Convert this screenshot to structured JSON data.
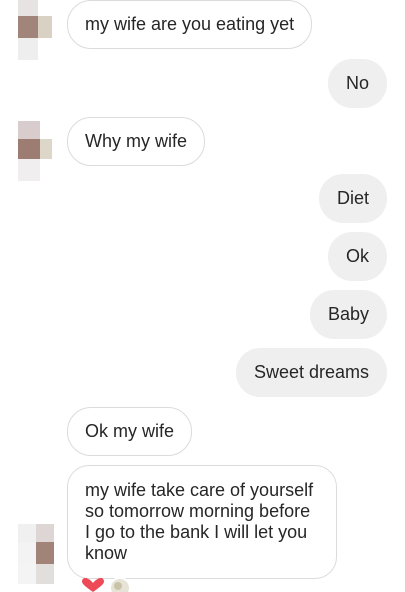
{
  "messages": [
    {
      "side": "incoming",
      "text": "my wife are you eating yet"
    },
    {
      "side": "outgoing",
      "text": "No"
    },
    {
      "side": "incoming",
      "text": "Why my wife"
    },
    {
      "side": "outgoing",
      "text": "Diet"
    },
    {
      "side": "outgoing",
      "text": "Ok"
    },
    {
      "side": "outgoing",
      "text": "Baby"
    },
    {
      "side": "outgoing",
      "text": "Sweet dreams"
    },
    {
      "side": "incoming",
      "text": "Ok my wife"
    },
    {
      "side": "incoming",
      "text": "my wife take care of yourself so tomorrow morning before I go to the bank I will let you know"
    }
  ],
  "reactions": [
    "heart-icon",
    "reactor-avatar"
  ],
  "colors": {
    "incoming_bg": "#ffffff",
    "incoming_border": "#dbdbdb",
    "outgoing_bg": "#efefef",
    "text": "#262626",
    "heart": "#ed4956"
  }
}
